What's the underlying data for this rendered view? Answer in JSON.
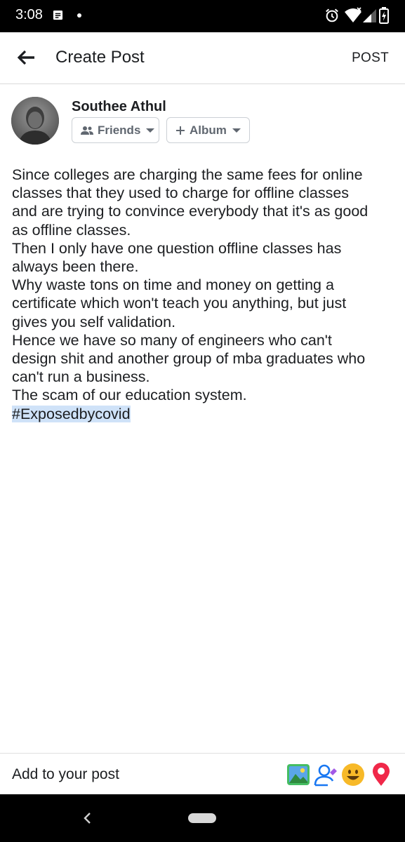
{
  "status_bar": {
    "time": "3:08",
    "icons": [
      "message-icon",
      "dot-icon",
      "alarm-icon",
      "wifi-icon",
      "signal-icon",
      "battery-icon"
    ]
  },
  "header": {
    "title": "Create Post",
    "post_label": "POST"
  },
  "author": {
    "name": "Southee Athul",
    "audience_label": "Friends",
    "album_label": "Album"
  },
  "composer": {
    "body": "Since colleges are charging the same fees for online classes that they used to charge for offline classes and are trying to convince everybody that it's as good as offline classes.\nThen I only have one question offline classes has always been there.\nWhy waste tons on time and money on getting a certificate which won't teach you anything, but just gives you self validation.\nHence we have so many of engineers who can't design shit and another group of mba graduates who can't run a business.\nThe scam of our education system.\n",
    "hashtag": "#Exposedbycovid"
  },
  "bottom_bar": {
    "label": "Add to your post",
    "actions": [
      "photo-icon",
      "tag-people-icon",
      "feeling-icon",
      "location-icon"
    ]
  },
  "colors": {
    "hashtag_highlight": "#cfe2f8",
    "photo_green": "#45bd62",
    "tag_blue": "#1877f2",
    "feeling_yellow": "#f7b928",
    "location_red": "#f02849"
  }
}
